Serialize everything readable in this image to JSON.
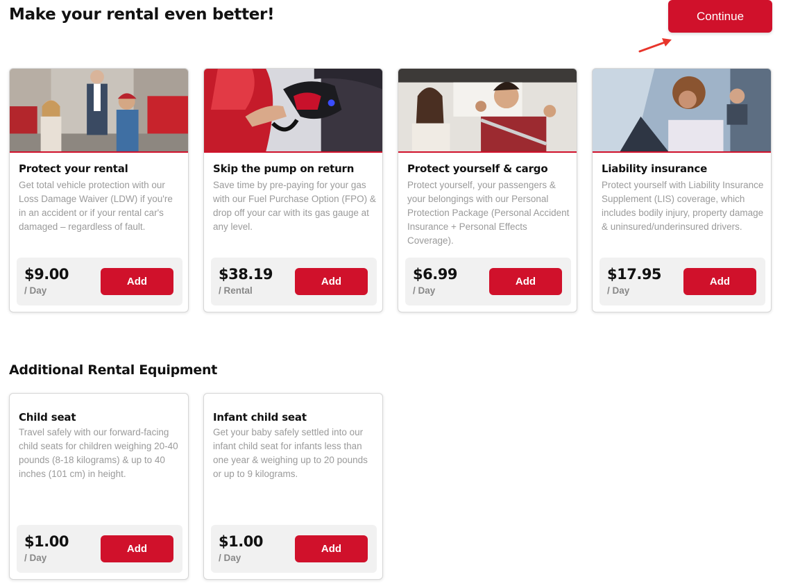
{
  "header": {
    "title": "Make your rental even better!",
    "continue_label": "Continue"
  },
  "protections": [
    {
      "title": "Protect your rental",
      "description": "Get total vehicle protection with our Loss Damage Waiver (LDW) if you're in an accident or if your rental car's damaged – regardless of fault.",
      "price": "$9.00",
      "unit": "/ Day",
      "add_label": "Add"
    },
    {
      "title": "Skip the pump on return",
      "description": "Save time by pre-paying for your gas with our Fuel Purchase Option (FPO) & drop off your car with its gas gauge at any level.",
      "price": "$38.19",
      "unit": "/ Rental",
      "add_label": "Add"
    },
    {
      "title": "Protect yourself & cargo",
      "description": "Protect yourself, your passengers & your belongings with our Personal Protection Package (Personal Accident Insurance + Personal Effects Coverage).",
      "price": "$6.99",
      "unit": "/ Day",
      "add_label": "Add"
    },
    {
      "title": "Liability insurance",
      "description": "Protect yourself with Liability Insurance Supplement (LIS) coverage, which includes bodily injury, property damage & uninsured/underinsured drivers.",
      "price": "$17.95",
      "unit": "/ Day",
      "add_label": "Add"
    }
  ],
  "equipment_section": {
    "title": "Additional Rental Equipment",
    "items": [
      {
        "title": "Child seat",
        "description": "Travel safely with our forward-facing child seats for children weighing 20-40 pounds (8-18 kilograms) & up to 40 inches (101 cm) in height.",
        "price": "$1.00",
        "unit": "/ Day",
        "add_label": "Add"
      },
      {
        "title": "Infant child seat",
        "description": "Get your baby safely settled into our infant child seat for infants less than one year & weighing up to 20 pounds or up to 9 kilograms.",
        "price": "$1.00",
        "unit": "/ Day",
        "add_label": "Add"
      }
    ]
  },
  "colors": {
    "accent": "#d0112b",
    "price_box_bg": "#f1f1f1",
    "description_text": "#9a9a9a"
  },
  "icons": {
    "annotation": "arrow-icon"
  }
}
